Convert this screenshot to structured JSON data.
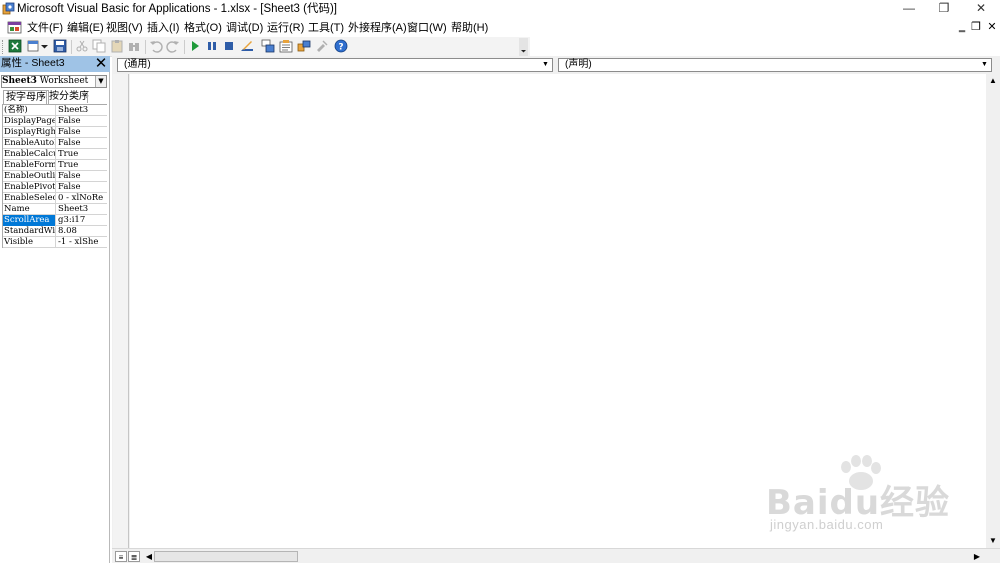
{
  "window": {
    "title": "Microsoft Visual Basic for Applications - 1.xlsx - [Sheet3 (代码)]",
    "minimize_glyph": "—",
    "restore_glyph": "❐",
    "close_glyph": "✕"
  },
  "menu": {
    "items": [
      "文件(F)",
      "编辑(E)",
      "视图(V)",
      "插入(I)",
      "格式(O)",
      "调试(D)",
      "运行(R)",
      "工具(T)",
      "外接程序(A)",
      "窗口(W)",
      "帮助(H)"
    ],
    "mdi_min": "‗",
    "mdi_restore": "❐",
    "mdi_close": "✕"
  },
  "toolbar": {
    "icons": [
      "excel-view-icon",
      "insert-module-icon",
      "save-icon",
      "cut-icon",
      "copy-icon",
      "paste-icon",
      "find-icon",
      "undo-icon",
      "redo-icon",
      "run-icon",
      "break-icon",
      "reset-icon",
      "design-mode-icon",
      "project-explorer-icon",
      "properties-icon",
      "object-browser-icon",
      "toolbox-icon",
      "help-icon"
    ]
  },
  "properties": {
    "title": "属性 - Sheet3",
    "close_glyph": "✕",
    "object_name": "Sheet3",
    "object_type": "Worksheet",
    "tabs": [
      "按字母序",
      "按分类序"
    ],
    "rows": [
      {
        "name": "(名称)",
        "value": "Sheet3"
      },
      {
        "name": "DisplayPage",
        "value": "False"
      },
      {
        "name": "DisplayRigh",
        "value": "False"
      },
      {
        "name": "EnableAutoF",
        "value": "False"
      },
      {
        "name": "EnableCalcu",
        "value": "True"
      },
      {
        "name": "EnableForma",
        "value": "True"
      },
      {
        "name": "EnableOutli",
        "value": "False"
      },
      {
        "name": "EnablePivot",
        "value": "False"
      },
      {
        "name": "EnableSelec",
        "value": "0 - xlNoRe"
      },
      {
        "name": "Name",
        "value": "Sheet3"
      },
      {
        "name": "ScrollArea",
        "value": "g3:i17"
      },
      {
        "name": "StandardWid",
        "value": "8.08"
      },
      {
        "name": "Visible",
        "value": "-1 - xlShe"
      }
    ],
    "selected_row": 10
  },
  "code_window": {
    "object_combo": "(通用)",
    "procedure_combo": "(声明)",
    "combo_arrow": "▼",
    "view_procedure": "≡",
    "view_module": "≣",
    "scroll_up": "▲",
    "scroll_down": "▼",
    "scroll_left": "◀",
    "scroll_right": "▶"
  },
  "watermark": {
    "logo": "Baidu经验",
    "url": "jingyan.baidu.com"
  }
}
